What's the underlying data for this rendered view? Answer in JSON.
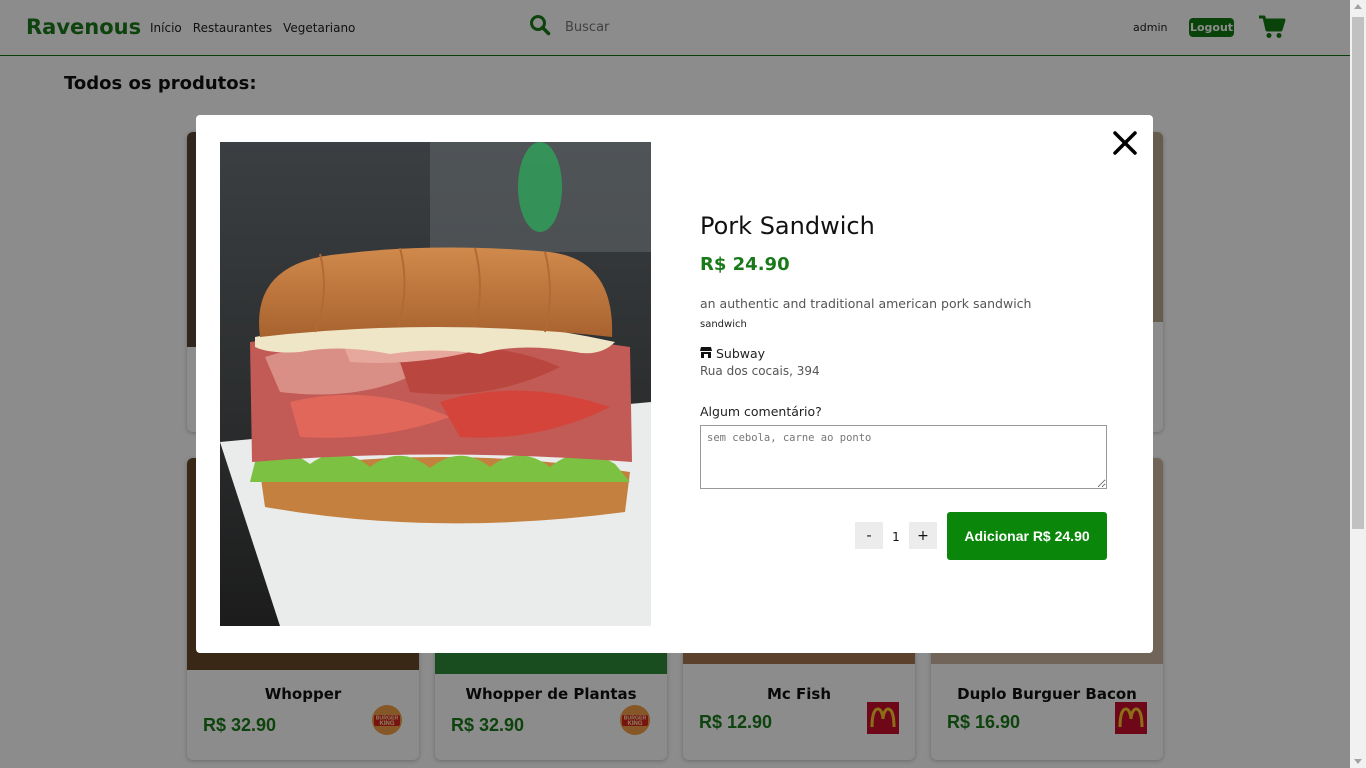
{
  "header": {
    "brand": "Ravenous",
    "nav": [
      "Início",
      "Restaurantes",
      "Vegetariano"
    ],
    "search_placeholder": "Buscar",
    "user": "admin",
    "logout_label": "Logout"
  },
  "page": {
    "title": "Todos os produtos:"
  },
  "products": [
    {
      "name": "Whopper",
      "price": "R$ 32.90",
      "store": "Burger King"
    },
    {
      "name": "Whopper de Plantas",
      "price": "R$ 32.90",
      "store": "Burger King"
    },
    {
      "name": "Mc Fish",
      "price": "R$ 12.90",
      "store": "McDonald's"
    },
    {
      "name": "Duplo Burguer Bacon",
      "price": "R$ 16.90",
      "store": "McDonald's"
    }
  ],
  "store_logos": {
    "burger_king_line1": "BURGER",
    "burger_king_line2": "KING"
  },
  "modal": {
    "name": "Pork Sandwich",
    "price": "R$ 24.90",
    "description": "an authentic and traditional american pork sandwich",
    "category": "sandwich",
    "store": "Subway",
    "address": "Rua dos cocais, 394",
    "comment_label": "Algum comentário?",
    "comment_placeholder": "sem cebola, carne ao ponto",
    "quantity": "1",
    "minus_label": "-",
    "plus_label": "+",
    "add_label": "Adicionar R$ 24.90"
  },
  "colors": {
    "brand_green": "#1a7a1a",
    "button_green": "#0a870a",
    "mcd_red": "#c8102e",
    "mcd_yellow": "#ffc72c",
    "bk_orange": "#f5a04a"
  },
  "icons": {
    "search": "search-icon",
    "cart": "cart-icon",
    "close": "close-icon",
    "store": "store-icon"
  }
}
